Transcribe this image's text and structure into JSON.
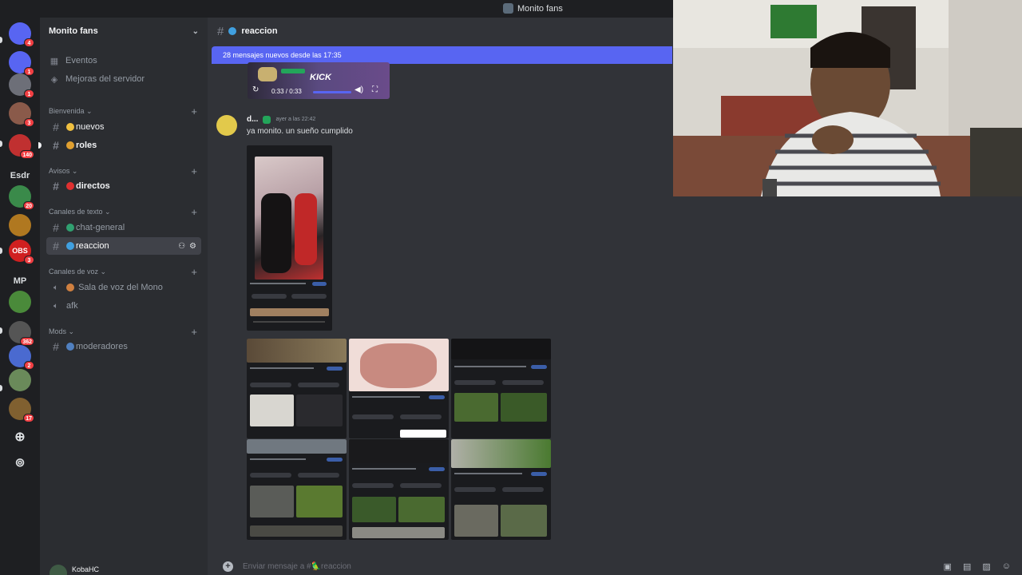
{
  "window": {
    "title": "Monito fans"
  },
  "colors": {
    "blurple": "#5865f2",
    "sidebar": "#2b2d31",
    "main": "#313338",
    "rail": "#1e1f22",
    "badge": "#f23f43"
  },
  "rail": {
    "servers": [
      {
        "name": "discord-home",
        "icon": "discord-icon",
        "badge": "4",
        "color": "#5865f2"
      },
      {
        "name": "server-2",
        "icon": "discord-icon",
        "badge": "1",
        "color": "#5865f2"
      },
      {
        "name": "server-3",
        "icon": "discord-icon",
        "badge": "1",
        "color": "#6d6f78"
      },
      {
        "name": "server-4",
        "badge": "3",
        "color": "#8a5a4a"
      },
      {
        "name": "server-5",
        "badge": "140",
        "color": "#c03030"
      },
      {
        "name": "server-esdr",
        "text": "Esdr"
      },
      {
        "name": "server-7",
        "badge": "20",
        "color": "#3a8a4a"
      },
      {
        "name": "server-8",
        "color": "#b07820"
      },
      {
        "name": "server-obs",
        "badge": "3",
        "color": "#d02020",
        "label": "OBS"
      },
      {
        "name": "server-mp",
        "text": "MP"
      },
      {
        "name": "server-11",
        "color": "#4a8a3a"
      },
      {
        "name": "server-12",
        "badge": "362",
        "color": "#555"
      },
      {
        "name": "server-13",
        "badge": "2",
        "color": "#4a6ad0"
      },
      {
        "name": "server-14",
        "color": "#6a8a5a"
      },
      {
        "name": "server-15",
        "badge": "17",
        "color": "#806030"
      }
    ],
    "add_icon": "plus-icon",
    "explore_icon": "compass-icon"
  },
  "sidebar": {
    "server_name": "Monito fans",
    "nav": [
      {
        "label": "Eventos",
        "icon": "calendar-icon"
      },
      {
        "label": "Mejoras del servidor",
        "icon": "boost-icon"
      }
    ],
    "categories": {
      "bienvenida": "Bienvenida",
      "avisos": "Avisos",
      "texto": "Canales de texto",
      "voz": "Canales de voz",
      "mods": "Mods"
    },
    "channels": {
      "nuevos": "nuevos",
      "roles": "roles",
      "directos": "directos",
      "chat_general": "chat-general",
      "reaccion": "reaccion",
      "sala_voz": "Sala de voz del Mono",
      "afk": "afk",
      "moderadores": "moderadores"
    },
    "user": {
      "name": "KobaHC"
    }
  },
  "main": {
    "channel_name": "reaccion",
    "new_messages_banner": "28 mensajes nuevos desde las 17:35",
    "player": {
      "brand": "KICK",
      "time": "0:33 / 0:33"
    },
    "message": {
      "author": "d...",
      "timestamp": "ayer a las 22:42",
      "text": "ya monito. un sueño cumplido"
    },
    "composer_placeholder": "Enviar mensaje a #🦜reaccion"
  }
}
